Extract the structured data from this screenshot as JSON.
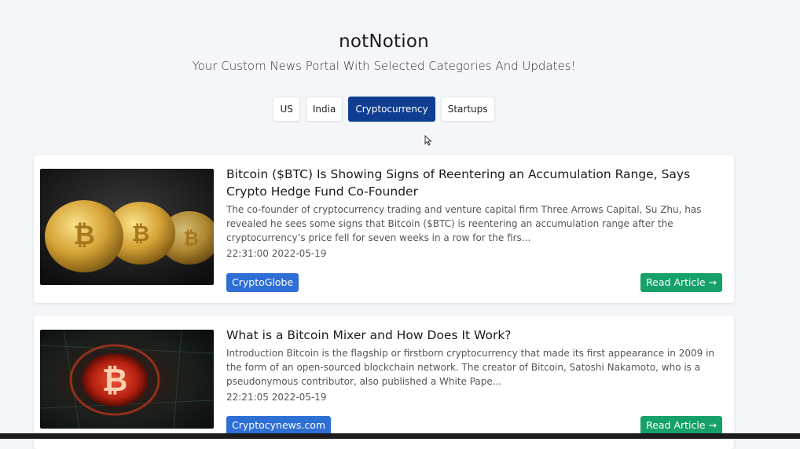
{
  "app": {
    "title": "notNotion",
    "subtitle": "Your Custom News Portal With Selected Categories And Updates!"
  },
  "tabs": [
    {
      "label": "US",
      "active": false
    },
    {
      "label": "India",
      "active": false
    },
    {
      "label": "Cryptocurrency",
      "active": true
    },
    {
      "label": "Startups",
      "active": false
    }
  ],
  "articles": [
    {
      "title": "Bitcoin ($BTC) Is Showing Signs of Reentering an Accumulation Range, Says Crypto Hedge Fund Co-Founder",
      "description": "The co-founder of cryptocurrency trading and venture capital firm Three Arrows Capital, Su Zhu, has revealed he sees some signs that Bitcoin ($BTC) is reentering an accumulation range after the cryptocurrency’s price fell for seven weeks in a row for the firs...",
      "time": "22:31:00 2022-05-19",
      "source": "CryptoGlobe",
      "read_label": "Read Article →"
    },
    {
      "title": "What is a Bitcoin Mixer and How Does It Work?",
      "description": "Introduction Bitcoin is the flagship or firstborn cryptocurrency that made its first appearance in 2009 in the form of an open-sourced blockchain network. The creator of Bitcoin, Satoshi Nakamoto, who is a pseudonymous contributor, also published a White Pape...",
      "time": "22:21:05 2022-05-19",
      "source": "Cryptocynews.com",
      "read_label": "Read Article →"
    }
  ],
  "colors": {
    "accent": "#0f3d91",
    "source_badge": "#2d6fd4",
    "read_button": "#16a06a"
  }
}
